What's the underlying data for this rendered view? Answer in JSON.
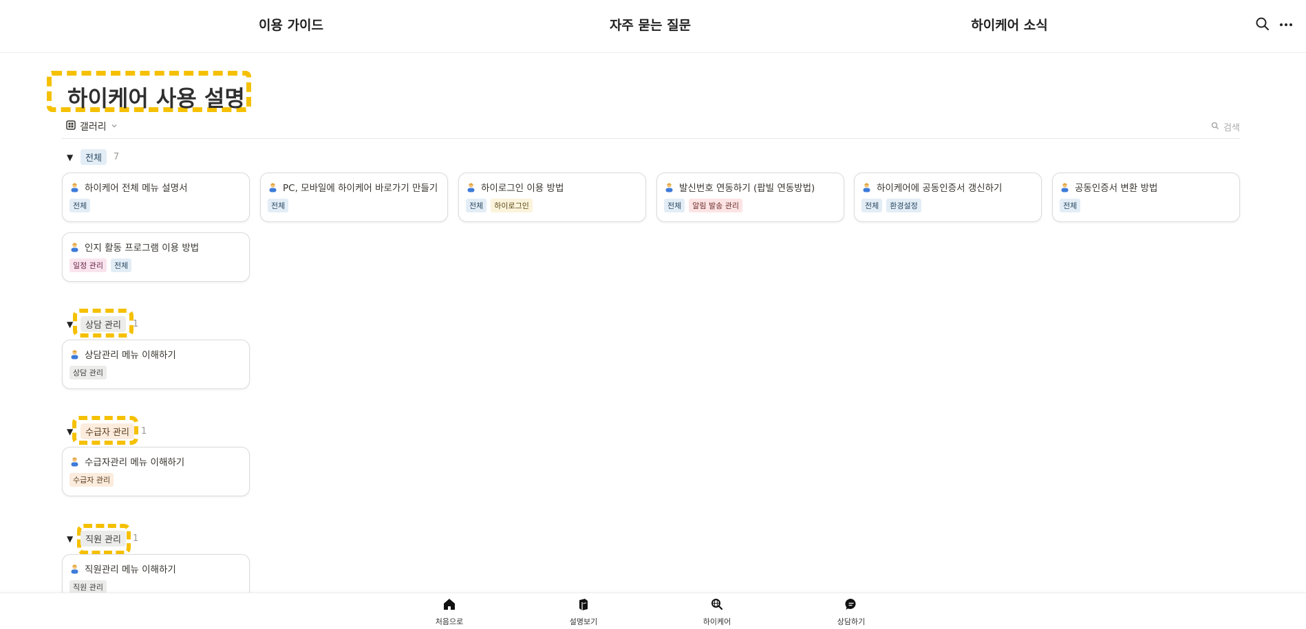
{
  "nav": {
    "items": [
      "이용 가이드",
      "자주 묻는 질문",
      "하이케어 소식"
    ],
    "search_icon": "search-icon",
    "more_icon": "more-horizontal-icon"
  },
  "page": {
    "title": "하이케어 사용 설명"
  },
  "view": {
    "tab_label": "갤러리",
    "search_placeholder": "검색"
  },
  "groups": [
    {
      "name": "전체",
      "count": "7",
      "cards": [
        {
          "title": "하이케어 전체 메뉴 설명서",
          "tags": [
            "전체"
          ]
        },
        {
          "title": "PC, 모바일에 하이케어 바로가기 만들기",
          "tags": [
            "전체"
          ]
        },
        {
          "title": "하이로그인 이용 방법",
          "tags": [
            "전체",
            "하이로그인"
          ]
        },
        {
          "title": "발신번호 연동하기 (팝빌 연동방법)",
          "tags": [
            "전체",
            "알림 발송 관리"
          ]
        },
        {
          "title": "하이케어에 공동인증서 갱신하기",
          "tags": [
            "전체",
            "환경설정"
          ]
        },
        {
          "title": "공동인증서 변환 방법",
          "tags": [
            "전체"
          ]
        },
        {
          "title": "인지 활동 프로그램 이용 방법",
          "tags": [
            "일정 관리",
            "전체"
          ]
        }
      ]
    },
    {
      "name": "상담 관리",
      "count": "1",
      "cards": [
        {
          "title": "상담관리 메뉴 이해하기",
          "tags": [
            "상담 관리"
          ]
        }
      ]
    },
    {
      "name": "수급자 관리",
      "count": "1",
      "cards": [
        {
          "title": "수급자관리 메뉴 이해하기",
          "tags": [
            "수급자 관리"
          ]
        }
      ]
    },
    {
      "name": "직원 관리",
      "count": "1",
      "cards": [
        {
          "title": "직원관리 메뉴 이해하기",
          "tags": [
            "직원 관리"
          ]
        }
      ]
    }
  ],
  "bottom_nav": [
    {
      "label": "처음으로",
      "icon": "home-icon"
    },
    {
      "label": "설명보기",
      "icon": "book-icon"
    },
    {
      "label": "하이케어",
      "icon": "globe-search-icon"
    },
    {
      "label": "상담하기",
      "icon": "chat-icon"
    }
  ],
  "colors": {
    "highlight": "#f5c000",
    "tag_blue": "#e3edf6",
    "tag_gray": "#ececeb",
    "tag_orange": "#fbecdd",
    "tag_red": "#fde4e4",
    "tag_pink": "#f9e4ee"
  }
}
